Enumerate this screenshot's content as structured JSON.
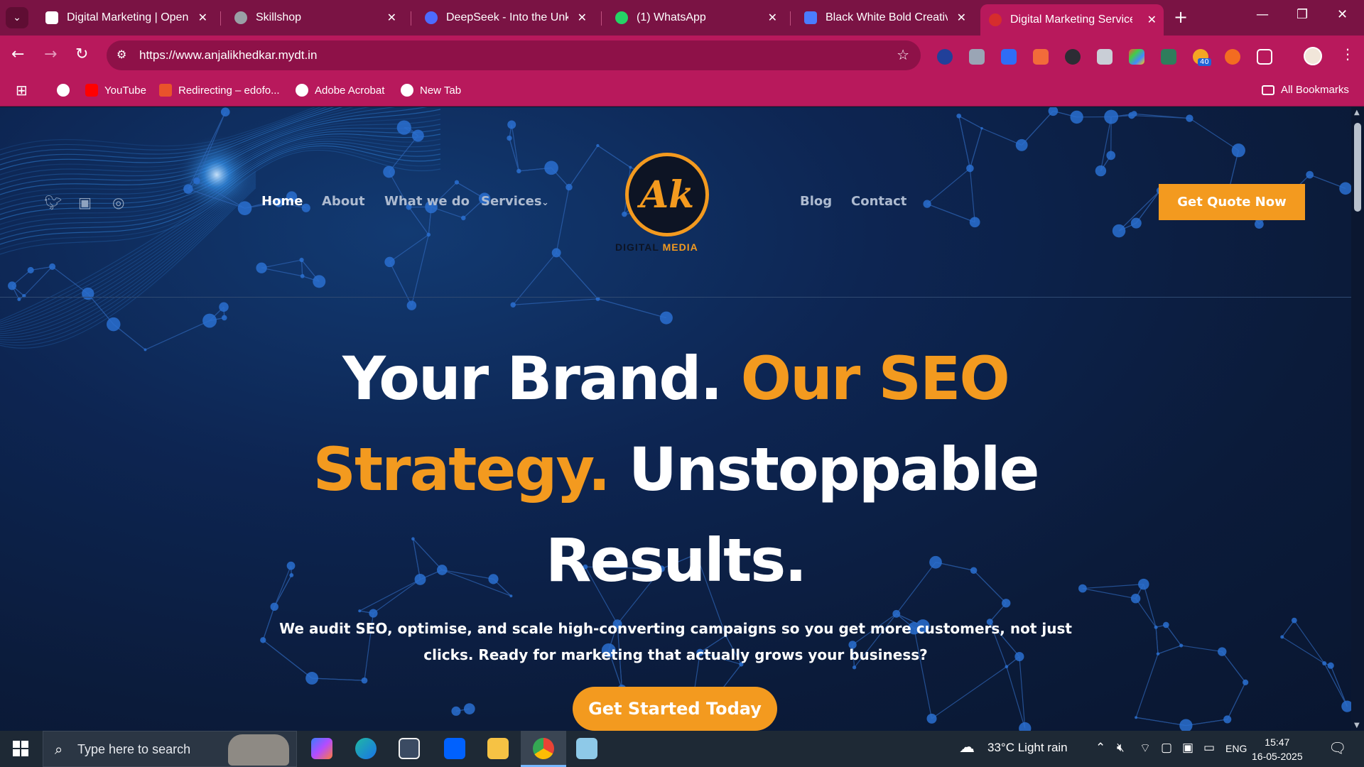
{
  "browser": {
    "tabs": [
      {
        "title": "Digital Marketing | Open R",
        "favicon_color": "#ffffff",
        "active": false
      },
      {
        "title": "Skillshop",
        "favicon_color": "#9aa0a6",
        "active": false
      },
      {
        "title": "DeepSeek - Into the Unkno",
        "favicon_color": "#4d6bfe",
        "active": false
      },
      {
        "title": "(1) WhatsApp",
        "favicon_color": "#25d366",
        "active": false
      },
      {
        "title": "Black White Bold Creative",
        "favicon_color": "#4a7cff",
        "active": false
      },
      {
        "title": "Digital Marketing Services",
        "favicon_color": "#d62d2d",
        "active": true
      }
    ],
    "new_tab_glyph": "+",
    "url": "https://www.anjalikhedkar.mydt.in",
    "extension_badge": "40",
    "bookmarks": [
      {
        "label": "",
        "icon": "google-icon",
        "color": "#ffffff"
      },
      {
        "label": "YouTube",
        "icon": "youtube-icon",
        "color": "#ff0000"
      },
      {
        "label": "Redirecting – edofo...",
        "icon": "edofolio-icon",
        "color": "#e9532b"
      },
      {
        "label": "Adobe Acrobat",
        "icon": "globe-icon",
        "color": "#ffffff"
      },
      {
        "label": "New Tab",
        "icon": "globe-icon",
        "color": "#ffffff"
      }
    ],
    "all_bookmarks": "All Bookmarks"
  },
  "site": {
    "nav": {
      "home": "Home",
      "about": "About",
      "what_we_do": "What we do",
      "services": "Services",
      "blog": "Blog",
      "contact": "Contact"
    },
    "logo": {
      "monogram": "Ak",
      "word1": "DIGITAL",
      "word2": "MEDIA"
    },
    "cta_top": "Get Quote Now",
    "hero": {
      "l1a": "Your Brand.",
      "l1b": "Our SEO",
      "l2a": "Strategy.",
      "l2b": "Unstoppable",
      "l3": "Results."
    },
    "subtitle": "We audit SEO, optimise, and scale high-converting campaigns so you get more customers, not just clicks. Ready for marketing that actually grows your business?",
    "cta_main": "Get Started Today",
    "colors": {
      "accent": "#f39a1f",
      "background": "#0b1a33"
    }
  },
  "taskbar": {
    "search_placeholder": "Type here to search",
    "weather": "33°C  Light rain",
    "language": "ENG",
    "time": "15:47",
    "date": "16-05-2025"
  }
}
